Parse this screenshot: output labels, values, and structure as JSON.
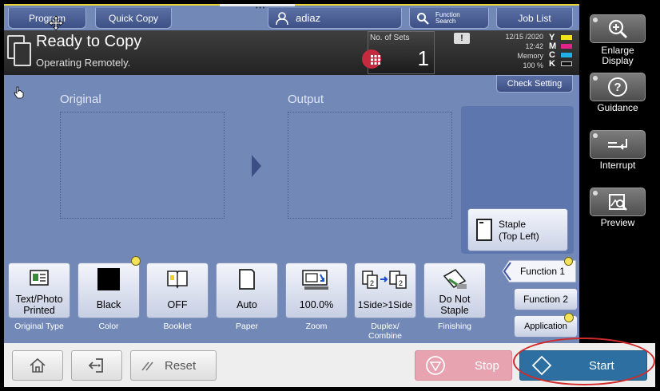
{
  "tabs": {
    "program": "Program",
    "quick_copy": "Quick Copy",
    "user": "adiaz",
    "function_search": [
      "Function",
      "Search"
    ],
    "job_list": "Job List"
  },
  "status": {
    "title": "Ready to Copy",
    "subtitle": "Operating Remotely.",
    "sets_label": "No. of Sets",
    "sets_value": "1",
    "date": "12/15 /2020",
    "time": "12:42",
    "memory_label": "Memory",
    "memory_value": "100 %",
    "toner": [
      "Y",
      "M",
      "C",
      "K"
    ]
  },
  "check_setting": "Check Setting",
  "labels": {
    "original": "Original",
    "output": "Output"
  },
  "staple_box": [
    "Staple",
    "(Top Left)"
  ],
  "functions": [
    {
      "label": [
        "Text/Photo",
        "Printed"
      ],
      "caption": [
        "Original Type"
      ]
    },
    {
      "label": [
        "Black"
      ],
      "caption": [
        "Color"
      ]
    },
    {
      "label": [
        "OFF"
      ],
      "caption": [
        "Booklet"
      ]
    },
    {
      "label": [
        "Auto"
      ],
      "caption": [
        "Paper"
      ]
    },
    {
      "label": [
        "100.0%"
      ],
      "caption": [
        "Zoom"
      ]
    },
    {
      "label": [
        "1Side>1Side"
      ],
      "caption": [
        "Duplex/",
        "Combine"
      ]
    },
    {
      "label": [
        "Do Not",
        "Staple"
      ],
      "caption": [
        "Finishing"
      ]
    }
  ],
  "side_buttons": {
    "function1": "Function 1",
    "function2": "Function 2",
    "application": "Application"
  },
  "right_panel": {
    "enlarge": [
      "Enlarge",
      "Display"
    ],
    "guidance": "Guidance",
    "interrupt": "Interrupt",
    "preview": "Preview"
  },
  "bottom": {
    "reset": "Reset",
    "stop": "Stop",
    "start": "Start"
  },
  "colors": {
    "background": "#7289b8",
    "stop": "#e8a3b0",
    "start": "#2d6fa0",
    "highlight_ellipse": "#d22a2a",
    "toner_y": "#f2e31c",
    "toner_m": "#e0248a",
    "toner_c": "#1fb0e6",
    "toner_k": "#111111"
  }
}
